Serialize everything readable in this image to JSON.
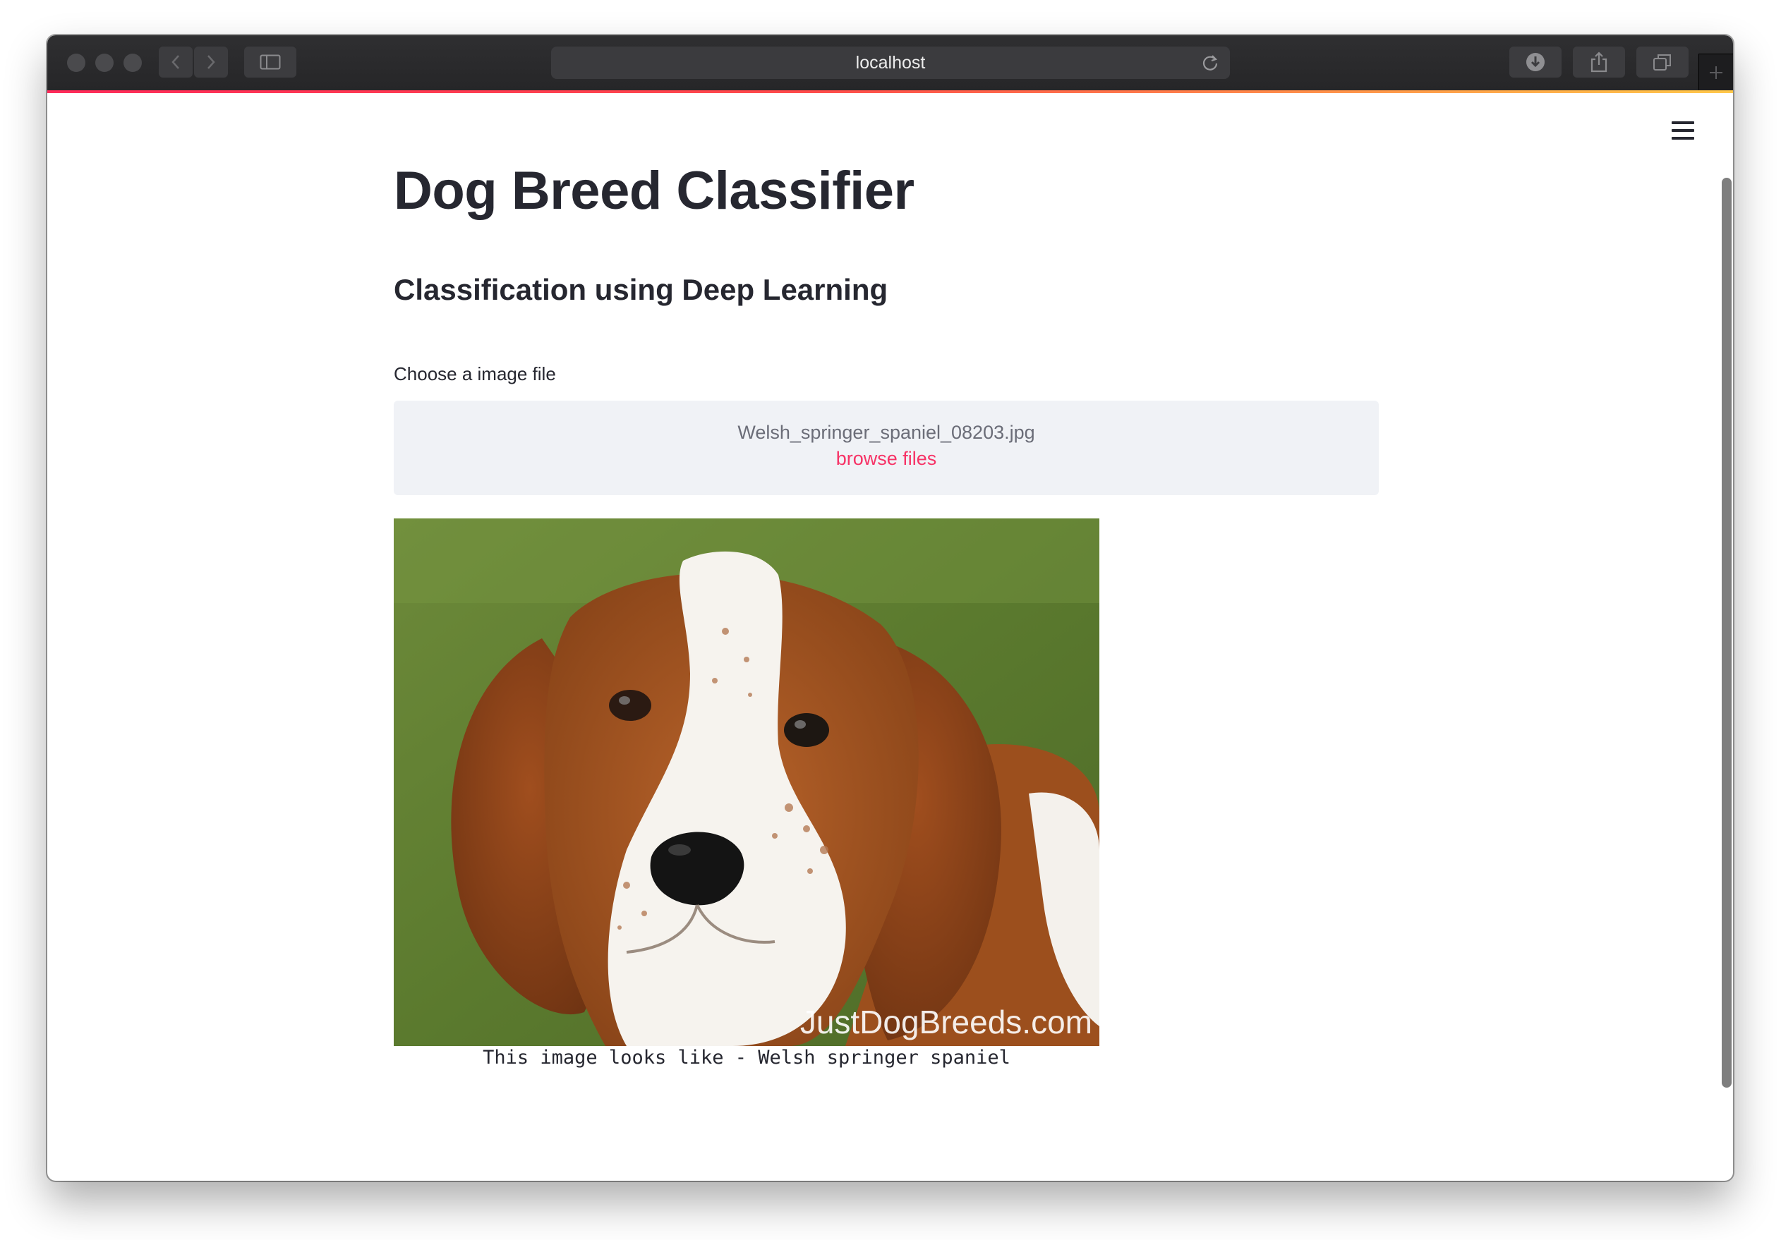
{
  "browser": {
    "url": "localhost"
  },
  "app": {
    "title": "Dog Breed Classifier",
    "subtitle": "Classification using Deep Learning",
    "uploader": {
      "label": "Choose a image file",
      "file_name": "Welsh_springer_spaniel_08203.jpg",
      "browse_label": "browse files"
    },
    "image": {
      "watermark": "JustDogBreeds.com"
    },
    "result": "This image looks like - Welsh springer spaniel"
  },
  "colors": {
    "accent": "#f63366",
    "text": "#262730",
    "dropzone_bg": "#f0f2f6"
  }
}
